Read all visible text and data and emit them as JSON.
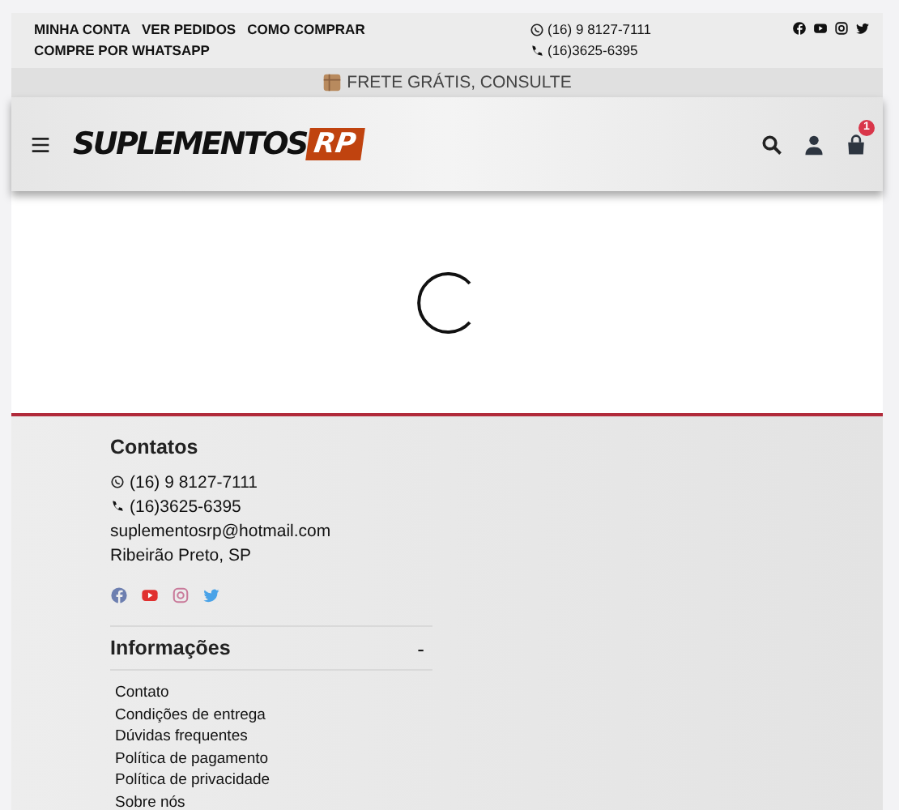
{
  "top_bar": {
    "links": [
      "MINHA CONTA",
      "VER PEDIDOS",
      "COMO COMPRAR",
      "COMPRE POR WHATSAPP"
    ],
    "whatsapp": "(16) 9 8127-7111",
    "phone": "(16)3625-6395"
  },
  "shipping_banner": "FRETE GRÁTIS, CONSULTE",
  "header": {
    "logo_main": "SUPLEMENTOS",
    "logo_badge": "RP",
    "cart_count": "1"
  },
  "footer": {
    "contacts": {
      "title": "Contatos",
      "whatsapp": "(16) 9 8127-7111",
      "phone": "(16)3625-6395",
      "email": "suplementosrp@hotmail.com",
      "city": "Ribeirão Preto, SP"
    },
    "info": {
      "title": "Informações",
      "toggle": "-",
      "links": [
        "Contato",
        "Condições de entrega",
        "Dúvidas frequentes",
        "Política de pagamento",
        "Política de privacidade",
        "Sobre nós"
      ]
    }
  }
}
